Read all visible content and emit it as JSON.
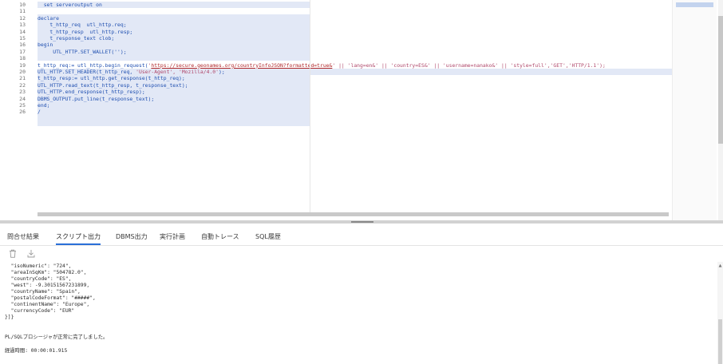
{
  "editor": {
    "lines": [
      {
        "n": "10",
        "segs": [
          {
            "t": "  set serveroutput on",
            "c": "kw"
          }
        ]
      },
      {
        "n": "11",
        "segs": []
      },
      {
        "n": "12",
        "segs": [
          {
            "t": "declare",
            "c": "kw"
          }
        ]
      },
      {
        "n": "13",
        "segs": [
          {
            "t": "    t_http_req  utl_http.req;",
            "c": "kw"
          }
        ]
      },
      {
        "n": "14",
        "segs": [
          {
            "t": "    t_http_resp  utl_http.resp;",
            "c": "kw"
          }
        ]
      },
      {
        "n": "15",
        "segs": [
          {
            "t": "    t_response_text clob;",
            "c": "kw"
          }
        ]
      },
      {
        "n": "16",
        "segs": [
          {
            "t": "begin",
            "c": "kw"
          }
        ]
      },
      {
        "n": "17",
        "segs": [
          {
            "t": "     UTL_HTTP.SET_WALLET('');",
            "c": "kw"
          }
        ]
      },
      {
        "n": "18",
        "segs": []
      },
      {
        "n": "19",
        "segs": [
          {
            "t": "t_http_req:= utl_http.begin_request(",
            "c": "kw"
          },
          {
            "t": "'",
            "c": "str"
          },
          {
            "t": "https://secure.geonames.org/countryInfoJSON?formatted=true&",
            "c": "url"
          },
          {
            "t": "' || 'lang=en&' || 'country=ES&' || 'username=nanako&' || 'style=full','GET','HTTP/1.1');",
            "c": "str"
          }
        ]
      },
      {
        "n": "20",
        "segs": [
          {
            "t": "UTL_HTTP.SET_HEADER(t_http_req, ",
            "c": "kw"
          },
          {
            "t": "'User-Agent', 'Mozilla/4.0'",
            "c": "str"
          },
          {
            "t": ");",
            "c": "kw"
          }
        ]
      },
      {
        "n": "21",
        "segs": [
          {
            "t": "t_http_resp:= utl_http.get_response(t_http_req);",
            "c": "kw"
          }
        ]
      },
      {
        "n": "22",
        "segs": [
          {
            "t": "UTL_HTTP.read_text(t_http_resp, t_response_text);",
            "c": "kw"
          }
        ]
      },
      {
        "n": "23",
        "segs": [
          {
            "t": "UTL_HTTP.end_response(t_http_resp);",
            "c": "kw"
          }
        ]
      },
      {
        "n": "24",
        "segs": [
          {
            "t": "DBMS_OUTPUT.put_line(t_response_text);",
            "c": "kw"
          }
        ]
      },
      {
        "n": "25",
        "segs": [
          {
            "t": "end;",
            "c": "kw"
          }
        ]
      },
      {
        "n": "26",
        "segs": [
          {
            "t": "/",
            "c": "kw"
          }
        ]
      }
    ]
  },
  "tabs": {
    "query_result": "問合せ結果",
    "script_output": "スクリプト出力",
    "dbms_output": "DBMS出力",
    "explain_plan": "実行計画",
    "autotrace": "自動トレース",
    "sql_history": "SQL履歴"
  },
  "toolbar": {
    "delete_icon": "trash-icon",
    "download_icon": "download-icon"
  },
  "output": {
    "lines": [
      "  \"isoNumeric\": \"724\",",
      "  \"areaInSqKm\": \"504782.0\",",
      "  \"countryCode\": \"ES\",",
      "  \"west\": -9.30151567231899,",
      "  \"countryName\": \"Spain\",",
      "  \"postalCodeFormat\": \"#####\",",
      "  \"continentName\": \"Europe\",",
      "  \"currencyCode\": \"EUR\"",
      "}]}"
    ],
    "status": "PL/SQLプロシージャが正常に完了しました。",
    "elapsed": "経過時間: 00:00:01.915"
  },
  "colors": {
    "accent": "#2a6fd8",
    "highlight": "#e2e8f6"
  }
}
